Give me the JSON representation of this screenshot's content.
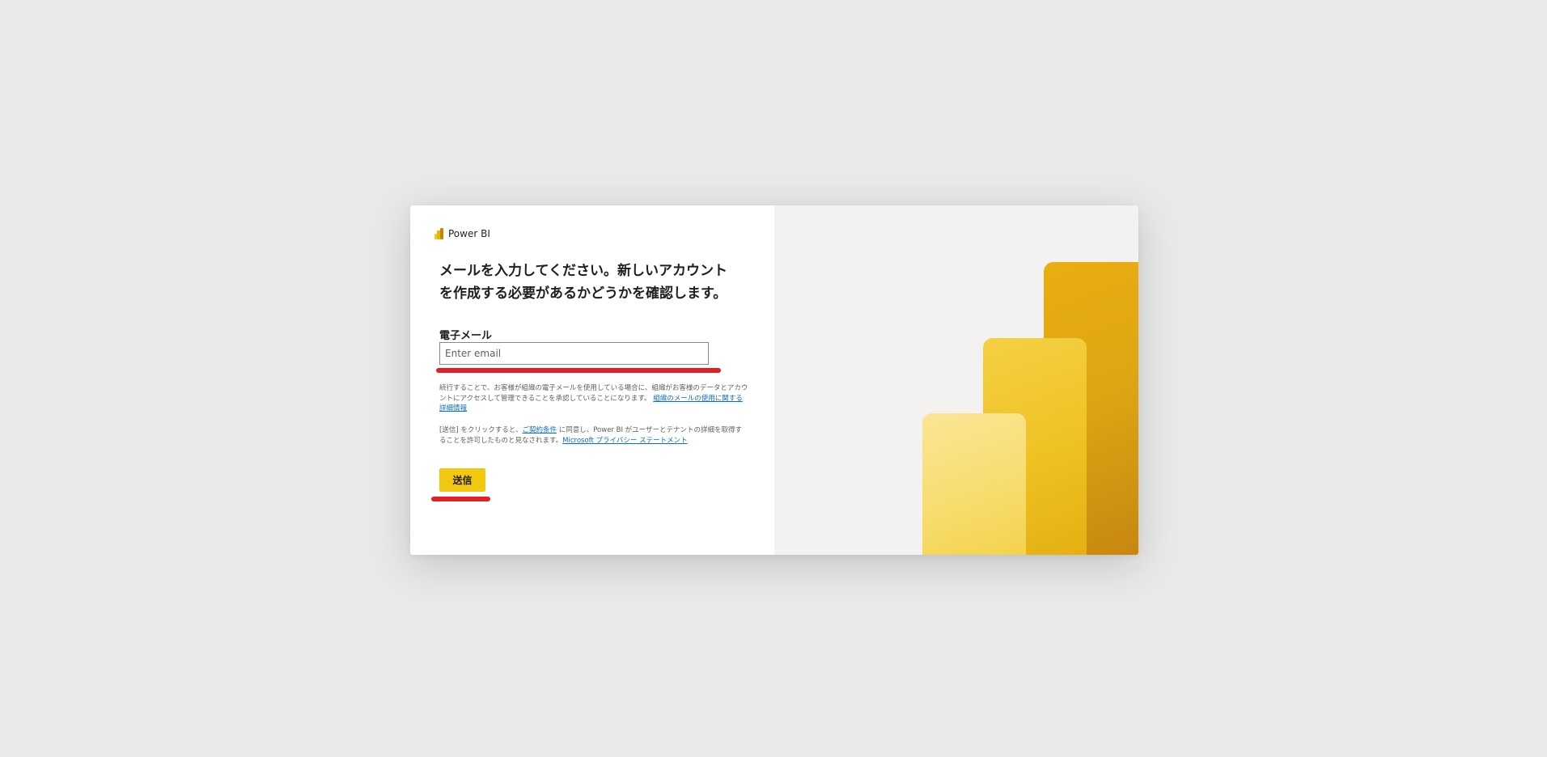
{
  "brand": {
    "name": "Power BI",
    "icon": "power-bi-logo-icon"
  },
  "heading": "メールを入力してください。新しいアカウントを作成する必要があるかどうかを確認します。",
  "email": {
    "label": "電子メール",
    "placeholder": "Enter email",
    "value": ""
  },
  "notice": {
    "text": "続行することで、お客様が組織の電子メールを使用している場合に、組織がお客様のデータとアカウントにアクセスして管理できることを承認していることになります。",
    "link": "組織のメールの使用に関する詳細情報"
  },
  "consent": {
    "text_before": "[送信] をクリックすると、",
    "terms_link": "ご契約条件",
    "text_middle": " に同意し、Power BI がユーザーとテナントの詳細を取得することを許可したものと見なされます。",
    "privacy_link": "Microsoft プライバシー ステートメント"
  },
  "submit_label": "送信",
  "colors": {
    "accent": "#f2c811",
    "annotation": "#e01f26",
    "link": "#0a6ec5",
    "side_panel": "#f3f2f1",
    "page_background": "#e9e9e9"
  }
}
